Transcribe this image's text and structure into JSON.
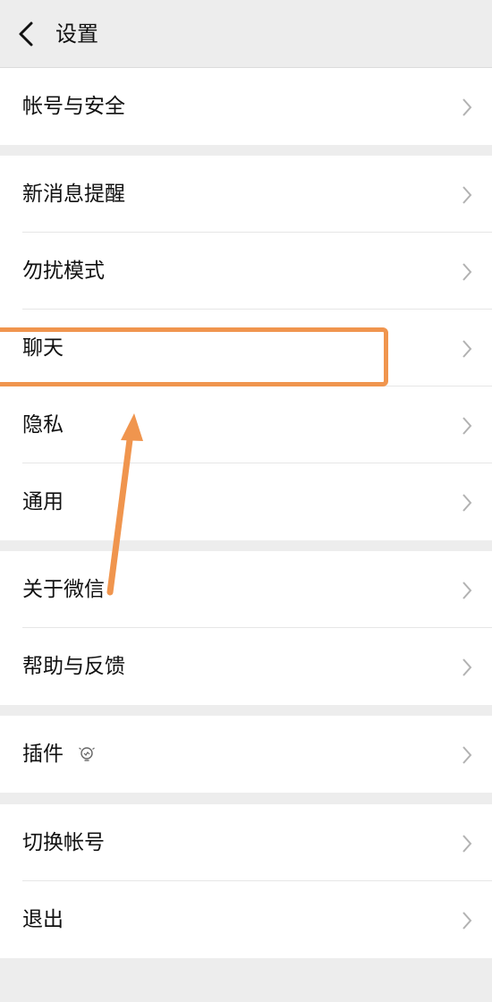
{
  "header": {
    "title": "设置",
    "back_icon": "chevron-left-icon"
  },
  "groups": [
    {
      "items": [
        {
          "label": "帐号与安全"
        }
      ]
    },
    {
      "items": [
        {
          "label": "新消息提醒"
        },
        {
          "label": "勿扰模式"
        },
        {
          "label": "聊天"
        },
        {
          "label": "隐私"
        },
        {
          "label": "通用"
        }
      ]
    },
    {
      "items": [
        {
          "label": "关于微信"
        },
        {
          "label": "帮助与反馈"
        }
      ]
    },
    {
      "items": [
        {
          "label": "插件",
          "icon": "lightbulb-icon"
        }
      ]
    },
    {
      "items": [
        {
          "label": "切换帐号"
        },
        {
          "label": "退出"
        }
      ]
    }
  ],
  "annotation": {
    "highlighted_item": "聊天",
    "highlight_color": "#f0954e"
  },
  "colors": {
    "background": "#ededed",
    "row_background": "#ffffff",
    "chevron": "#b2b2b2",
    "text": "#111111"
  }
}
